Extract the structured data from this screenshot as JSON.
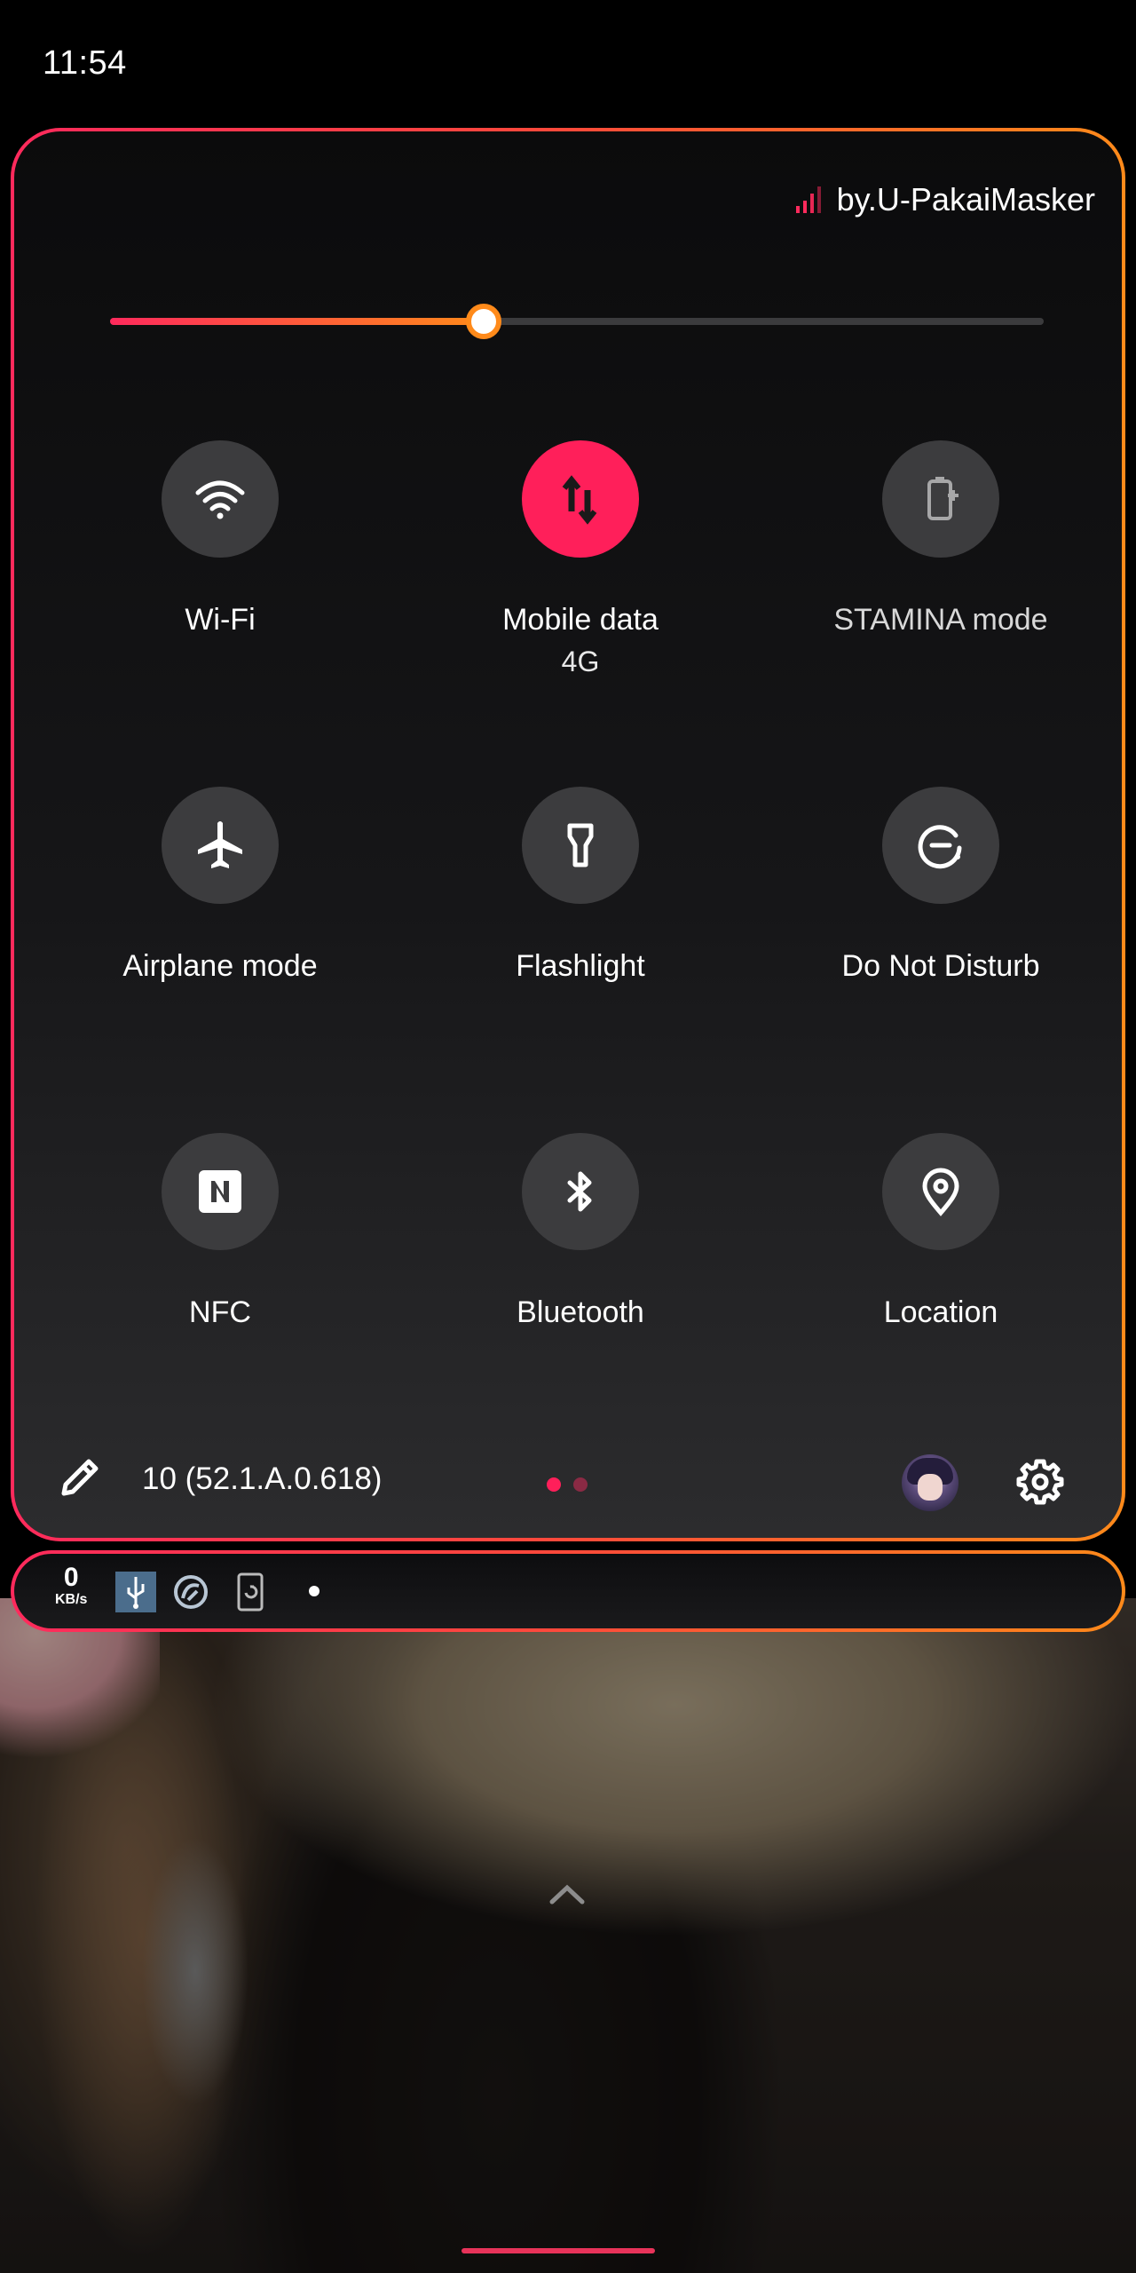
{
  "status_bar": {
    "time": "11:54"
  },
  "quick_settings": {
    "operator": "by.U-PakaiMasker",
    "brightness_level": 0.4,
    "tiles": [
      {
        "label": "Wi-Fi",
        "sublabel": "",
        "icon": "wifi-icon",
        "active": false
      },
      {
        "label": "Mobile data",
        "sublabel": "4G",
        "icon": "mobile-data-icon",
        "active": true
      },
      {
        "label": "STAMINA mode",
        "sublabel": "",
        "icon": "battery-plus-icon",
        "active": false
      },
      {
        "label": "Airplane mode",
        "sublabel": "",
        "icon": "airplane-icon",
        "active": false
      },
      {
        "label": "Flashlight",
        "sublabel": "",
        "icon": "flashlight-icon",
        "active": false
      },
      {
        "label": "Do Not Disturb",
        "sublabel": "",
        "icon": "dnd-icon",
        "active": false
      },
      {
        "label": "NFC",
        "sublabel": "",
        "icon": "nfc-icon",
        "active": false
      },
      {
        "label": "Bluetooth",
        "sublabel": "",
        "icon": "bluetooth-icon",
        "active": false
      },
      {
        "label": "Location",
        "sublabel": "",
        "icon": "location-icon",
        "active": false
      }
    ],
    "footer": {
      "build_number": "10 (52.1.A.0.618)",
      "page_count": 2,
      "current_page": 1
    }
  },
  "notification_strip": {
    "net_speed_value": "0",
    "net_speed_unit": "KB/s",
    "icons": [
      "usb-icon",
      "sync-app-icon",
      "auto-rotate-icon"
    ]
  },
  "colors": {
    "accent_pink": "#ff1f5a",
    "accent_orange": "#ff8a1a",
    "tile_inactive": "#3c3c3e",
    "dot_inactive": "#8a2a44"
  }
}
